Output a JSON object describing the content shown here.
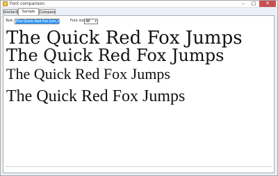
{
  "window": {
    "title": "Font comparison",
    "minimize_glyph": "–",
    "maximize_glyph": "□",
    "close_glyph": "✕"
  },
  "tabs": [
    {
      "label": "Similarity"
    },
    {
      "label": "Sample text"
    },
    {
      "label": "Compare"
    }
  ],
  "active_tab": "Sample text",
  "controls": {
    "text_label": "Text:",
    "text_value": "The Quick Red Fox Jumps",
    "font_size_label": "Font size",
    "font_size_value": "48"
  },
  "samples": [
    {
      "text": "The Quick Red Fox Jumps"
    },
    {
      "text": "The Quick Red Fox Jumps"
    },
    {
      "text": "The Quick Red Fox Jumps"
    },
    {
      "text": "The Quick Red Fox Jumps"
    }
  ]
}
